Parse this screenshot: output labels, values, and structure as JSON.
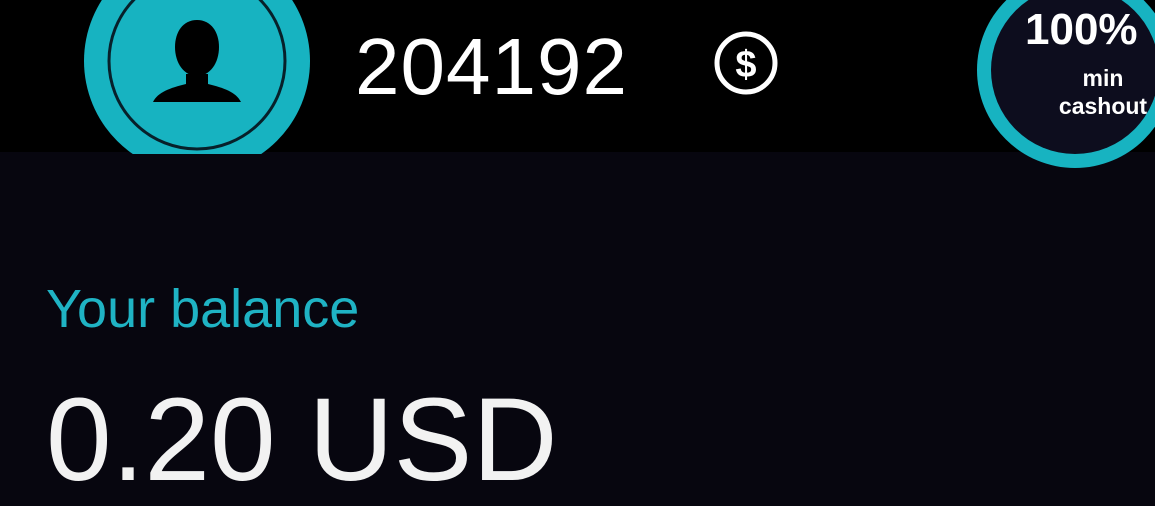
{
  "header": {
    "user_id": "204192",
    "avatar_icon": "user-silhouette-icon",
    "currency_icon": "dollar-circle-icon"
  },
  "cashout_badge": {
    "percent": "100%",
    "label": "min\ncashout",
    "progress": 1.0
  },
  "balance": {
    "label": "Your balance",
    "value": "0.20 USD"
  },
  "colors": {
    "accent": "#1fb3c4",
    "background": "#07060f",
    "header_bg": "#000000",
    "text_primary": "#ffffff"
  }
}
